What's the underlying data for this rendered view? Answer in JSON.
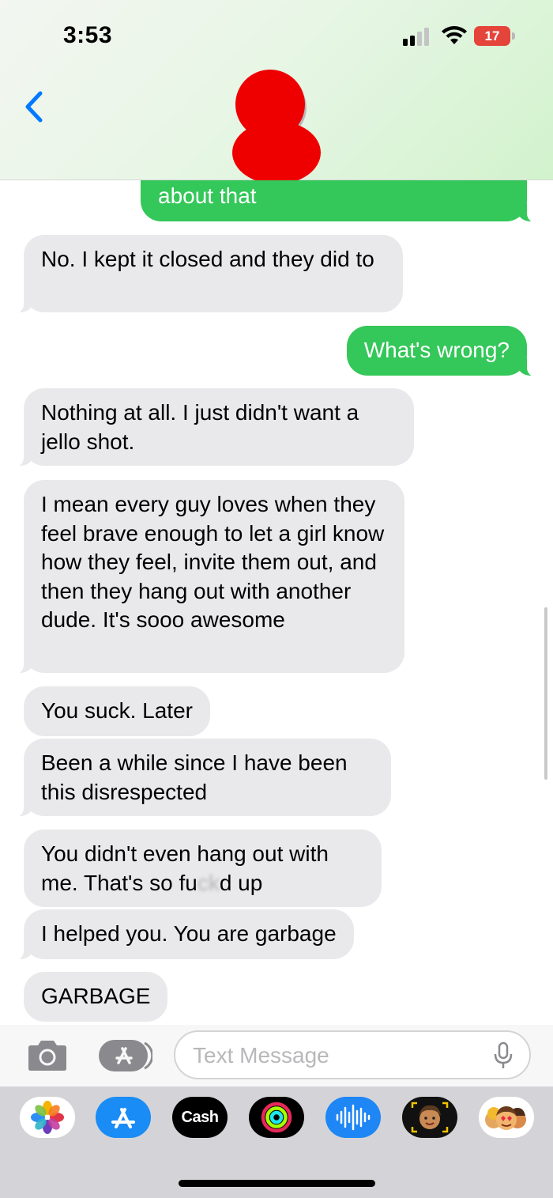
{
  "status_bar": {
    "time": "3:53",
    "battery": "17"
  },
  "header": {
    "back_icon": "chevron-left-icon",
    "contact_avatar": "redacted-avatar"
  },
  "messages": [
    {
      "dir": "sent",
      "text": "about that"
    },
    {
      "dir": "received",
      "text": "No. I kept it closed and they did to"
    },
    {
      "dir": "sent",
      "text": "What's wrong?"
    },
    {
      "dir": "received",
      "text": "Nothing at all. I just didn't want a jello shot."
    },
    {
      "dir": "received",
      "text": "I mean every guy loves when they feel brave enough to let a girl know how they feel, invite them out, and then they hang out with another dude. It's sooo awesome"
    },
    {
      "dir": "received",
      "text": "You suck. Later"
    },
    {
      "dir": "received",
      "text": "Been a while since I have been this disrespected"
    },
    {
      "dir": "received",
      "text_before": "You didn't even hang out with me. That's so fu",
      "text_censored": "ck",
      "text_after": "d up"
    },
    {
      "dir": "received",
      "text": "I helped you. You are garbage"
    },
    {
      "dir": "received",
      "text": "GARBAGE"
    }
  ],
  "compose": {
    "placeholder": "Text Message",
    "value": ""
  },
  "app_drawer": {
    "apps": [
      "Photos",
      "App Store",
      "Cash",
      "Fitness",
      "Audio Message",
      "Memoji",
      "Memoji Stickers"
    ],
    "cash_label": "Cash"
  },
  "colors": {
    "sent_bubble": "#34c759",
    "received_bubble": "#e9e9eb",
    "accent": "#007aff",
    "battery_low": "#e5443b"
  }
}
